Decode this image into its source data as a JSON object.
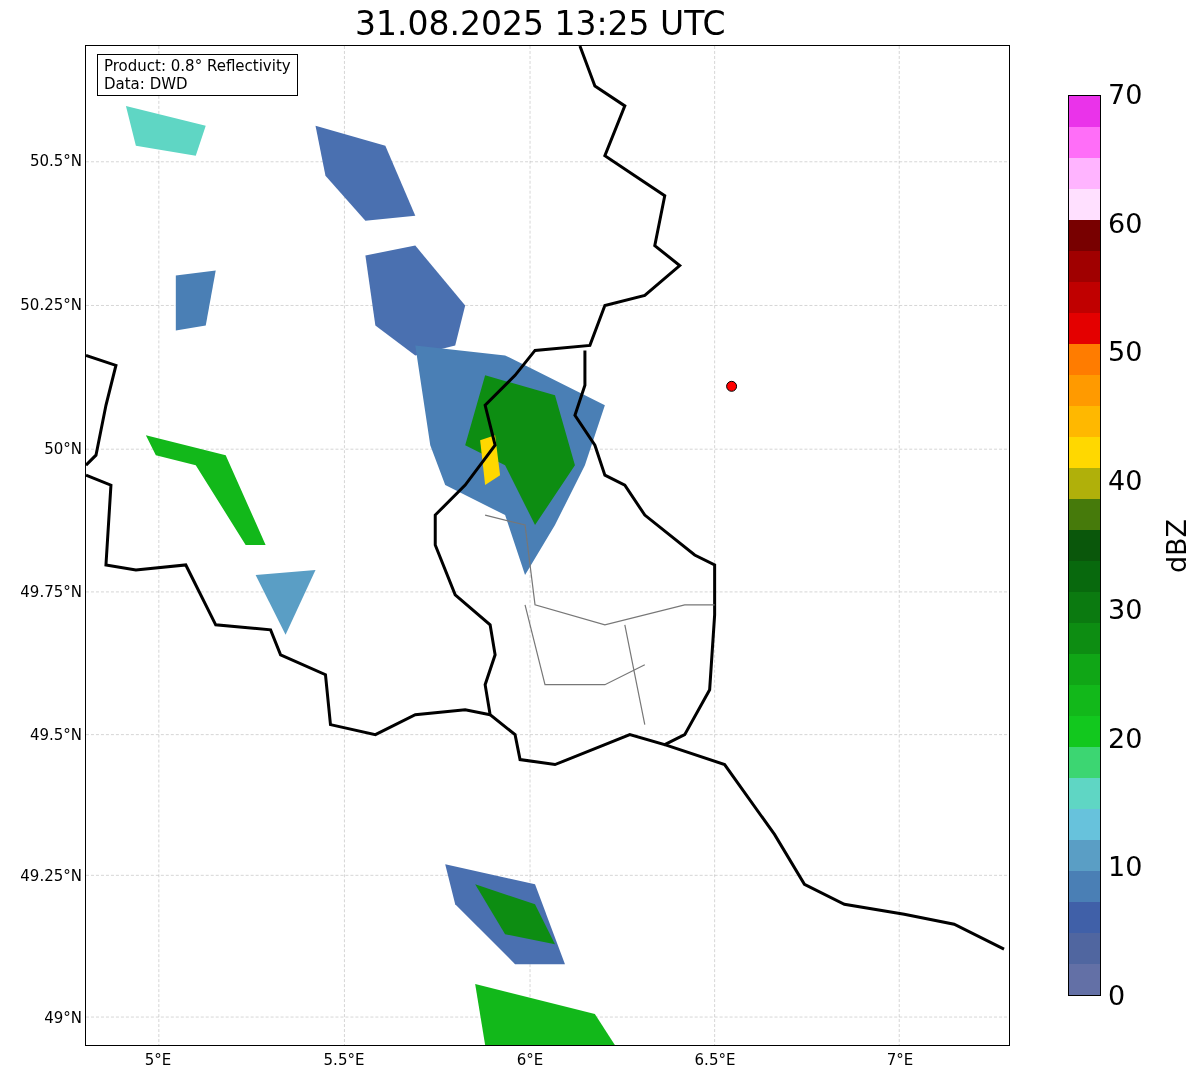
{
  "title": "31.08.2025 13:25 UTC",
  "info_box": {
    "lines": [
      "Product: 0.8° Reflectivity",
      "Data: DWD"
    ]
  },
  "map": {
    "y_ticks": [
      "50.5°N",
      "50.25°N",
      "50°N",
      "49.75°N",
      "49.5°N",
      "49.25°N",
      "49°N"
    ],
    "x_ticks": [
      "5°E",
      "5.5°E",
      "6°E",
      "6.5°E",
      "7°E"
    ]
  },
  "colorbar": {
    "label": "dBZ",
    "ticks": [
      "70",
      "60",
      "50",
      "40",
      "30",
      "20",
      "10",
      "0"
    ],
    "bands": [
      {
        "color": "#6370a6"
      },
      {
        "color": "#5066a0"
      },
      {
        "color": "#4060a8"
      },
      {
        "color": "#4a7fb5"
      },
      {
        "color": "#5a9ec5"
      },
      {
        "color": "#67c2dc"
      },
      {
        "color": "#5fd6c4"
      },
      {
        "color": "#3cd672"
      },
      {
        "color": "#12c81e"
      },
      {
        "color": "#12b81a"
      },
      {
        "color": "#10a616"
      },
      {
        "color": "#0d8d12"
      },
      {
        "color": "#0b7a10"
      },
      {
        "color": "#08690d"
      },
      {
        "color": "#0a570b"
      },
      {
        "color": "#467a0b"
      },
      {
        "color": "#b0b00a"
      },
      {
        "color": "#ffd800"
      },
      {
        "color": "#ffb800"
      },
      {
        "color": "#ff9a00"
      },
      {
        "color": "#ff7c00"
      },
      {
        "color": "#e40000"
      },
      {
        "color": "#c00000"
      },
      {
        "color": "#a00000"
      },
      {
        "color": "#780000"
      },
      {
        "color": "#ffe0ff"
      },
      {
        "color": "#ffb4ff"
      },
      {
        "color": "#ff6ef8"
      },
      {
        "color": "#ea33ea"
      }
    ]
  }
}
